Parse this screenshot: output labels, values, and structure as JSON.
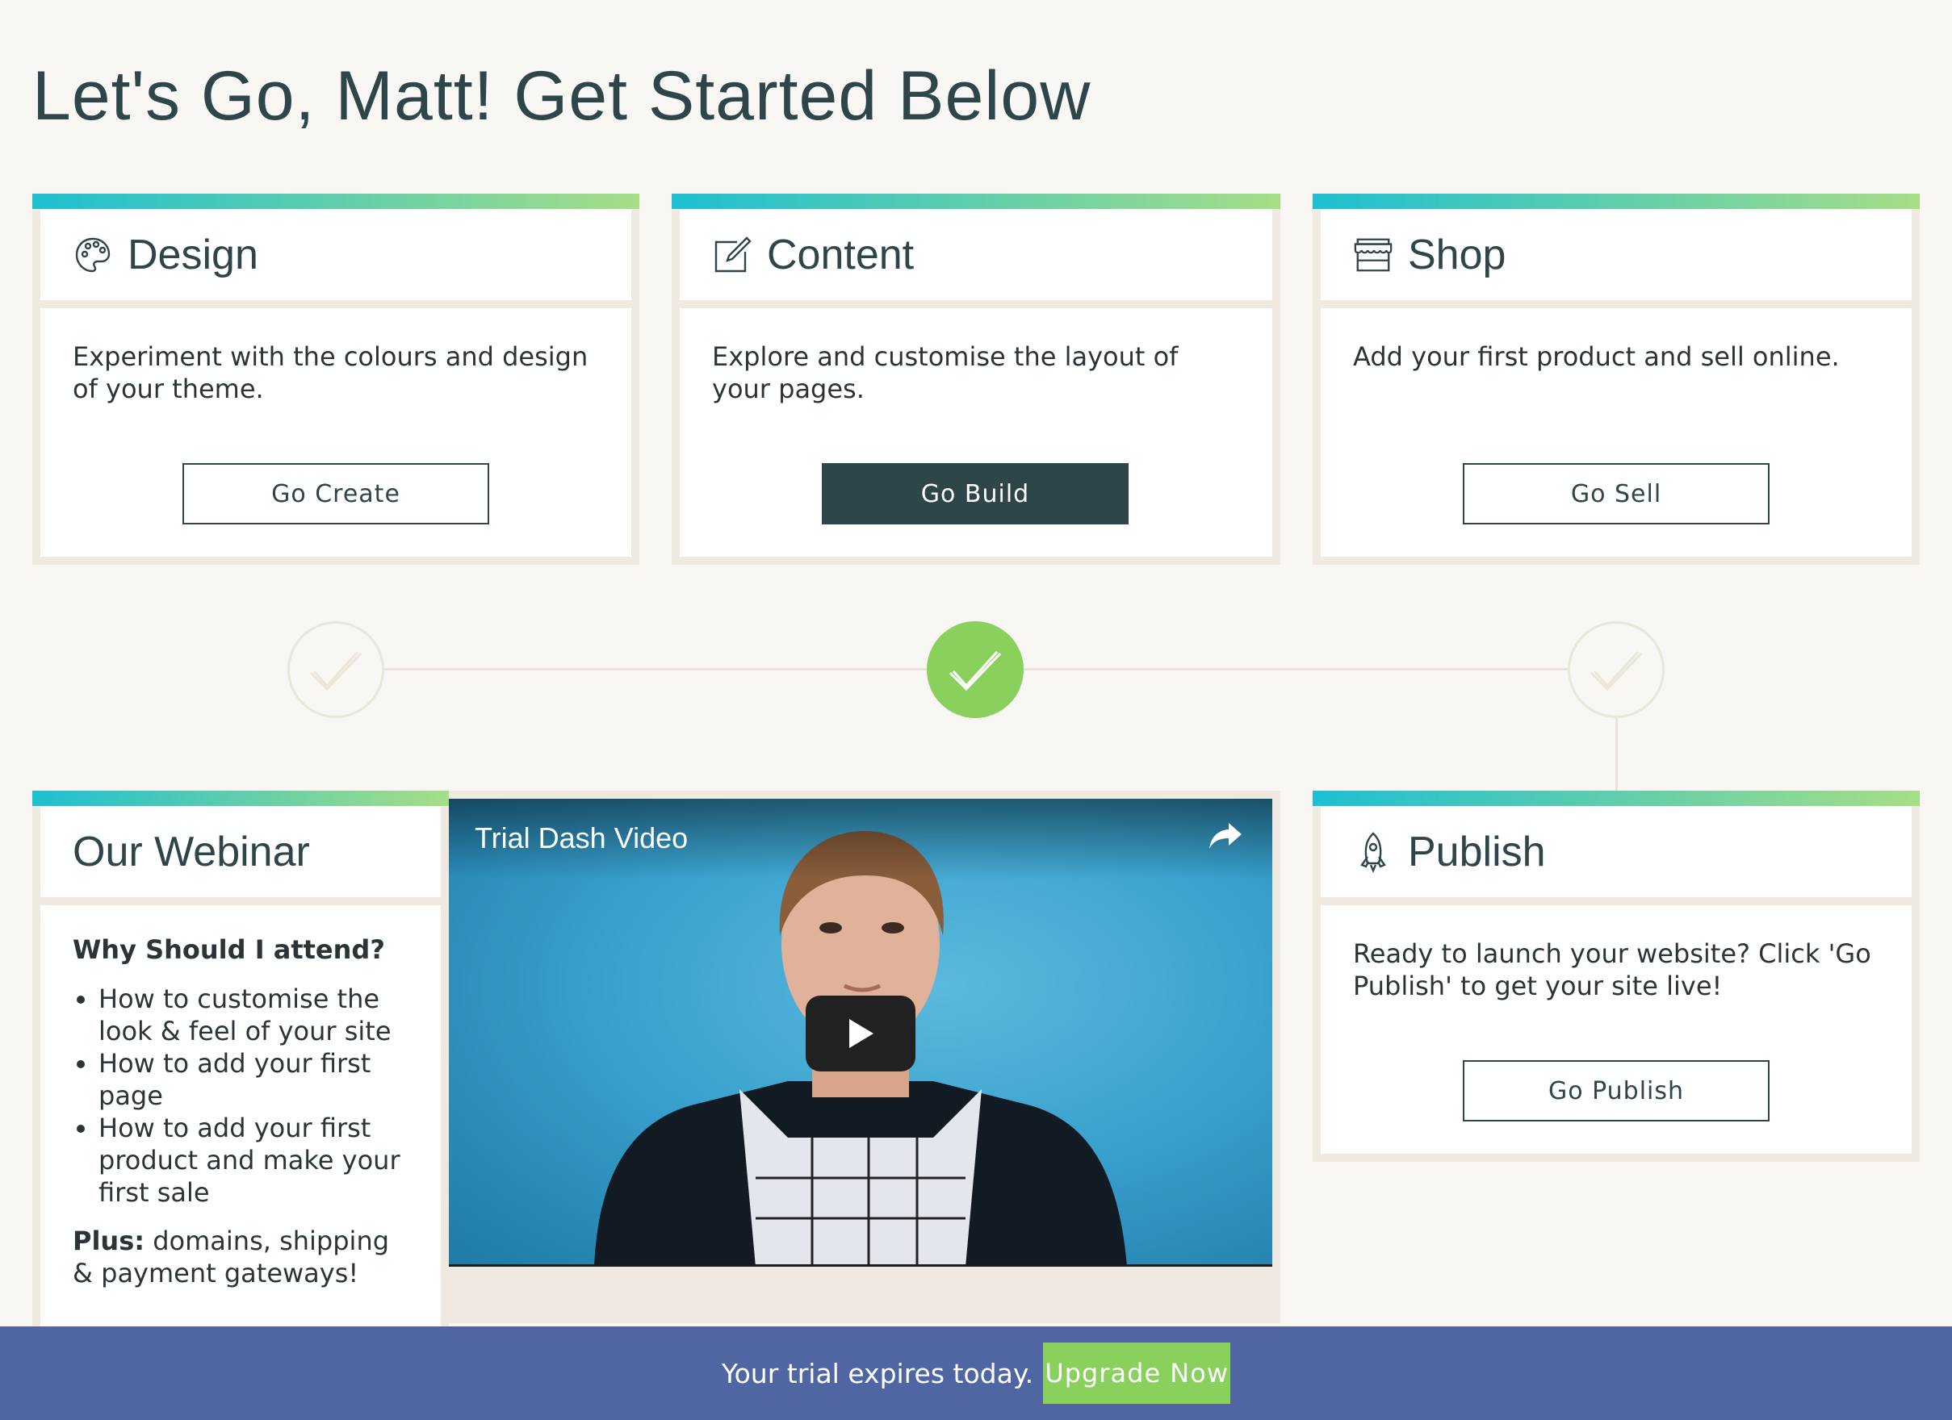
{
  "header": {
    "title": "Let's Go, Matt! Get Started Below"
  },
  "cards": {
    "design": {
      "title": "Design",
      "icon": "palette-icon",
      "description": "Experiment with the colours and design of your theme.",
      "button": "Go Create"
    },
    "content": {
      "title": "Content",
      "icon": "edit-icon",
      "description": "Explore and customise the layout of your pages.",
      "button": "Go Build"
    },
    "shop": {
      "title": "Shop",
      "icon": "storefront-icon",
      "description": "Add your first product and sell online.",
      "button": "Go Sell"
    },
    "publish": {
      "title": "Publish",
      "icon": "rocket-icon",
      "description": "Ready to launch your website? Click 'Go Publish' to get your site live!",
      "button": "Go Publish"
    }
  },
  "progress": {
    "steps": [
      {
        "name": "design",
        "complete": false
      },
      {
        "name": "content",
        "complete": true
      },
      {
        "name": "shop",
        "complete": false
      }
    ]
  },
  "webinar": {
    "title": "Our Webinar",
    "heading": "Why Should I attend?",
    "bullets": [
      "How to customise the look & feel of your site",
      "How to add your first page",
      "How to add your first product and make your first sale"
    ],
    "plus_label": "Plus:",
    "plus_text": " domains, shipping & payment gateways!"
  },
  "video": {
    "title": "Trial Dash Video",
    "share_icon": "share-icon",
    "play_icon": "play-icon"
  },
  "trial": {
    "message": "Your trial expires today.",
    "upgrade_label": "Upgrade Now"
  },
  "colors": {
    "accent_green": "#8ad05c",
    "dark_teal": "#2e4549",
    "trial_bar": "#5066a2",
    "gradient_start": "#1dbfd2",
    "gradient_end": "#a6de86"
  }
}
